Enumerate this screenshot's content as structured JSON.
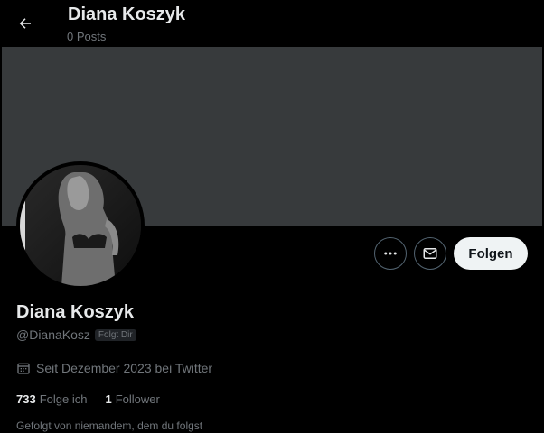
{
  "header": {
    "title": "Diana Koszyk",
    "post_count": "0 Posts"
  },
  "profile": {
    "display_name": "Diana Koszyk",
    "handle": "@DianaKosz",
    "follows_you_badge": "Folgt Dir",
    "joined": "Seit Dezember 2023 bei Twitter",
    "following_count": "733",
    "following_label": "Folge ich",
    "followers_count": "1",
    "followers_label": "Follower",
    "followed_by_text": "Gefolgt von niemandem, dem du folgst"
  },
  "actions": {
    "follow_label": "Folgen",
    "more_icon": "more-icon",
    "message_icon": "message-icon"
  },
  "colors": {
    "background": "#000000",
    "banner": "#373a3c",
    "text_primary": "#e7e9ea",
    "text_secondary": "#71767b",
    "follow_button_bg": "#eff3f4"
  }
}
